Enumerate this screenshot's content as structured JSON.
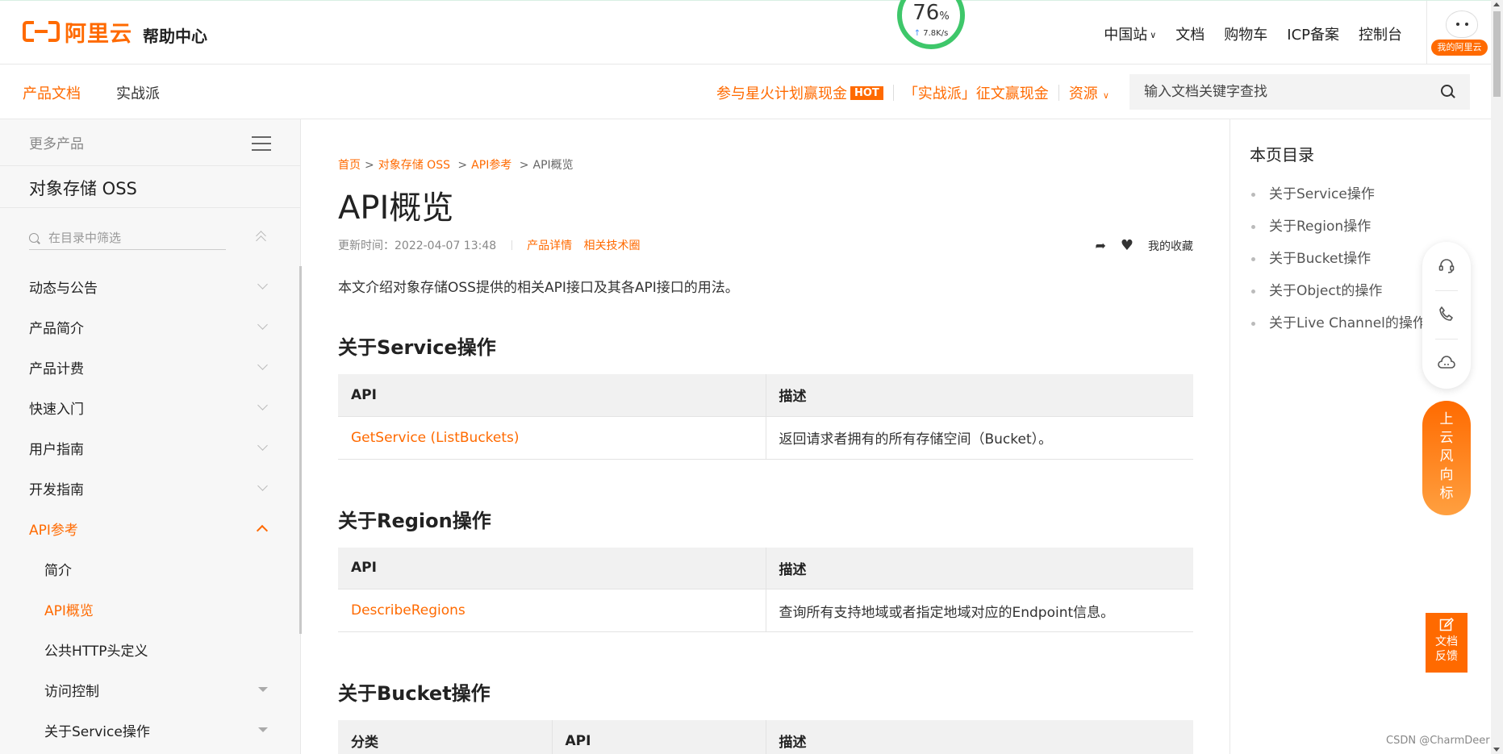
{
  "header": {
    "logo_text": "阿里云",
    "help_center": "帮助中心",
    "speed": {
      "percent": "76",
      "unit": "%",
      "rate": "7.8K/s"
    },
    "nav": [
      "中国站",
      "文档",
      "购物车",
      "ICP备案",
      "控制台"
    ],
    "my_aliyun": "我的阿里云"
  },
  "subheader": {
    "tabs": [
      "产品文档",
      "实战派"
    ],
    "promo_1": "参与星火计划赢现金",
    "promo_hot": "HOT",
    "promo_2": "「实战派」征文赢现金",
    "resources": "资源",
    "search_placeholder": "输入文档关键字查找"
  },
  "sidebar": {
    "more_products": "更多产品",
    "product_name": "对象存储 OSS",
    "filter_placeholder": "在目录中筛选",
    "items": [
      {
        "label": "动态与公告"
      },
      {
        "label": "产品简介"
      },
      {
        "label": "产品计费"
      },
      {
        "label": "快速入门"
      },
      {
        "label": "用户指南"
      },
      {
        "label": "开发指南"
      },
      {
        "label": "API参考"
      },
      {
        "label": "简介"
      },
      {
        "label": "API概览"
      },
      {
        "label": "公共HTTP头定义"
      },
      {
        "label": "访问控制"
      },
      {
        "label": "关于Service操作"
      }
    ]
  },
  "main": {
    "breadcrumb": [
      "首页",
      "对象存储 OSS",
      "API参考",
      "API概览"
    ],
    "title": "API概览",
    "updated": "更新时间：2022-04-07 13:48",
    "link_product": "产品详情",
    "link_community": "相关技术圈",
    "favorites": "我的收藏",
    "intro": "本文介绍对象存储OSS提供的相关API接口及其各API接口的用法。",
    "sections": [
      {
        "title": "关于Service操作",
        "headers": [
          "API",
          "描述"
        ],
        "rows": [
          {
            "api": "GetService (ListBuckets)",
            "desc": "返回请求者拥有的所有存储空间（Bucket）。"
          }
        ]
      },
      {
        "title": "关于Region操作",
        "headers": [
          "API",
          "描述"
        ],
        "rows": [
          {
            "api": "DescribeRegions",
            "desc": "查询所有支持地域或者指定地域对应的Endpoint信息。"
          }
        ]
      },
      {
        "title": "关于Bucket操作",
        "headers": [
          "分类",
          "API",
          "描述"
        ]
      }
    ]
  },
  "toc": {
    "title": "本页目录",
    "items": [
      "关于Service操作",
      "关于Region操作",
      "关于Bucket操作",
      "关于Object的操作",
      "关于Live Channel的操作"
    ]
  },
  "floating": {
    "cloud_vane": [
      "上",
      "云",
      "风",
      "向",
      "标"
    ],
    "feedback": [
      "文档",
      "反馈"
    ]
  },
  "watermark": "CSDN @CharmDeer",
  "colors": {
    "accent": "#ff6a00",
    "speed_ring": "#3ec76a"
  }
}
